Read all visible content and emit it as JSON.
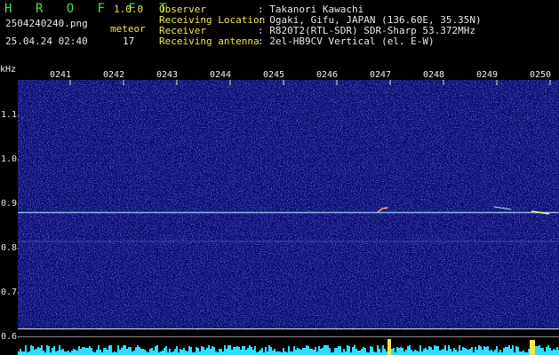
{
  "app": {
    "name": "H R O F F T",
    "version": "1.0.0",
    "filename": "2504240240.png",
    "timestamp": "25.04.24 02:40",
    "meteor_label": "meteor",
    "meteor_count": "17"
  },
  "info": {
    "observer_label": "Observer",
    "observer_value": ": Takanori Kawachi",
    "location_label": "Receiving Location",
    "location_value": ": Ogaki, Gifu, JAPAN (136.60E, 35.35N)",
    "receiver_label": "Receiver",
    "receiver_value": ": R820T2(RTL-SDR) SDR-Sharp 53.372MHz",
    "antenna_label": "Receiving antenna",
    "antenna_value": ": 2el-HB9CV Vertical (el. E-W)"
  },
  "axis": {
    "unit": "kHz",
    "y_ticks": [
      "1.1",
      "1.0",
      "0.9",
      "0.8",
      "0.7",
      "0.6"
    ],
    "time_ticks": [
      "0241",
      "0242",
      "0243",
      "0244",
      "0245",
      "0246",
      "0247",
      "0248",
      "0249",
      "0250"
    ]
  },
  "colors": {
    "background": "#000000",
    "header_green": "#46e046",
    "header_yellow": "#f2e84a",
    "spectrum_bg": "#0c0f6e",
    "signal_line": "#9fd4ff",
    "level_bar": "#28e0ff"
  }
}
